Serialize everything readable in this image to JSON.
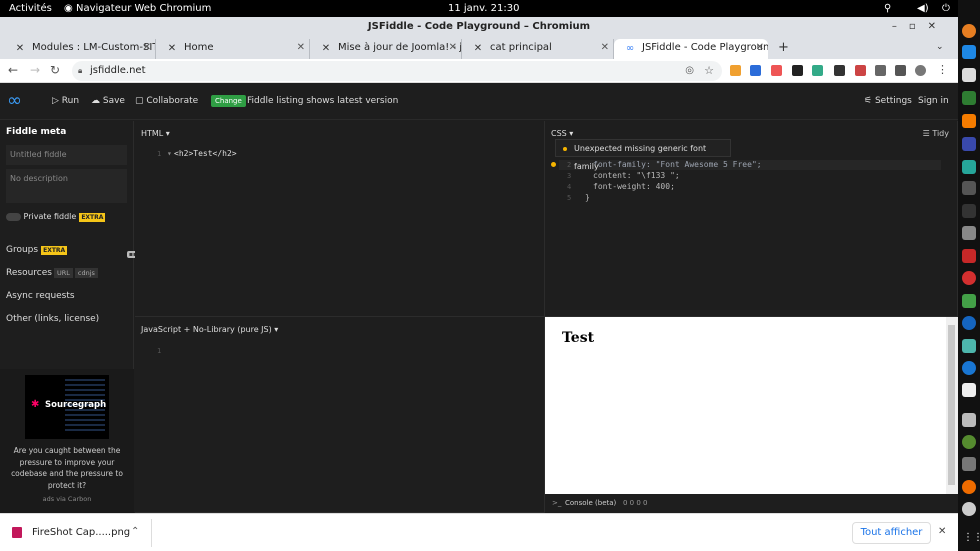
{
  "system_bar": {
    "activities": "Activités",
    "app_name": "Navigateur Web Chromium",
    "clock": "11 janv.  21:30"
  },
  "window": {
    "title": "JSFiddle - Code Playground – Chromium"
  },
  "tabs": [
    {
      "label": "Modules : LM-Custom-SIT",
      "icon": "joomla-icon"
    },
    {
      "label": "Home",
      "icon": "joomla-icon"
    },
    {
      "label": "Mise à jour de Joomla! - jo",
      "icon": "joomla-icon"
    },
    {
      "label": "cat principal",
      "icon": "joomla-icon"
    },
    {
      "label": "JSFiddle - Code Playgroun",
      "icon": "jsfiddle-icon"
    }
  ],
  "address": {
    "url": "jsfiddle.net"
  },
  "header": {
    "run": "Run",
    "save": "Save",
    "collaborate": "Collaborate",
    "change_badge": "Change",
    "listing_text": "Fiddle listing shows latest version",
    "settings": "Settings",
    "signin": "Sign in"
  },
  "sidebar": {
    "title": "Fiddle meta",
    "title_placeholder": "Untitled fiddle",
    "desc_placeholder": "No description",
    "private_label": "Private fiddle",
    "extra": "EXTRA",
    "groups": "Groups",
    "resources": "Resources",
    "url_tag": "URL",
    "cdnjs_tag": "cdnjs",
    "async": "Async requests",
    "other": "Other (links, license)"
  },
  "ad": {
    "brand": "Sourcegraph",
    "text": "Are you caught between the pressure to improve your codebase and the pressure to protect it?",
    "via": "ads via Carbon"
  },
  "html_panel": {
    "label": "HTML ▾",
    "line1": "<h2>Test</h2>",
    "ln1": "1"
  },
  "css_panel": {
    "label": "CSS ▾",
    "tidy": "Tidy",
    "tooltip": "Unexpected missing generic font family",
    "lines": [
      {
        "n": "2",
        "text": "font-family: \"Font Awesome 5 Free\";"
      },
      {
        "n": "3",
        "text": "content: \"\\f133 \";"
      },
      {
        "n": "4",
        "text": "font-weight: 400;"
      },
      {
        "n": "5",
        "text": "}"
      }
    ]
  },
  "js_panel": {
    "label": "JavaScript + No-Library (pure JS) ▾",
    "ln1": "1"
  },
  "output": {
    "heading": "Test"
  },
  "console": {
    "label": "Console (beta)",
    "counts": "0   0   0   0"
  },
  "download": {
    "file": "FireShot Cap.....png",
    "show_all": "Tout afficher"
  }
}
